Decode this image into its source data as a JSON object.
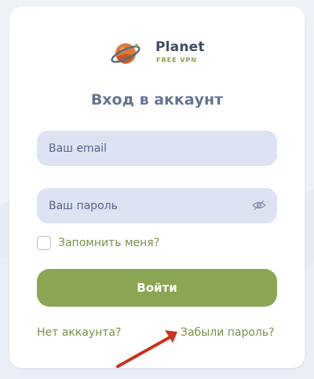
{
  "logo": {
    "name": "Planet",
    "subtitle": "FREE VPN"
  },
  "form": {
    "title": "Вход в аккаунт",
    "email_placeholder": "Ваш email",
    "password_placeholder": "Ваш пароль",
    "remember_label": "Запомнить меня?",
    "login_label": "Войти",
    "no_account_link": "Нет аккаунта?",
    "forgot_password_link": "Забыли пароль?"
  },
  "colors": {
    "accent_green": "#8aa652",
    "title_blue": "#627592",
    "input_bg": "#dde3f2",
    "arrow_red": "#c8321e"
  },
  "icons": {
    "logo": "planet-logo-icon",
    "password_toggle": "eye-hidden-icon",
    "annotation": "red-arrow-icon"
  }
}
